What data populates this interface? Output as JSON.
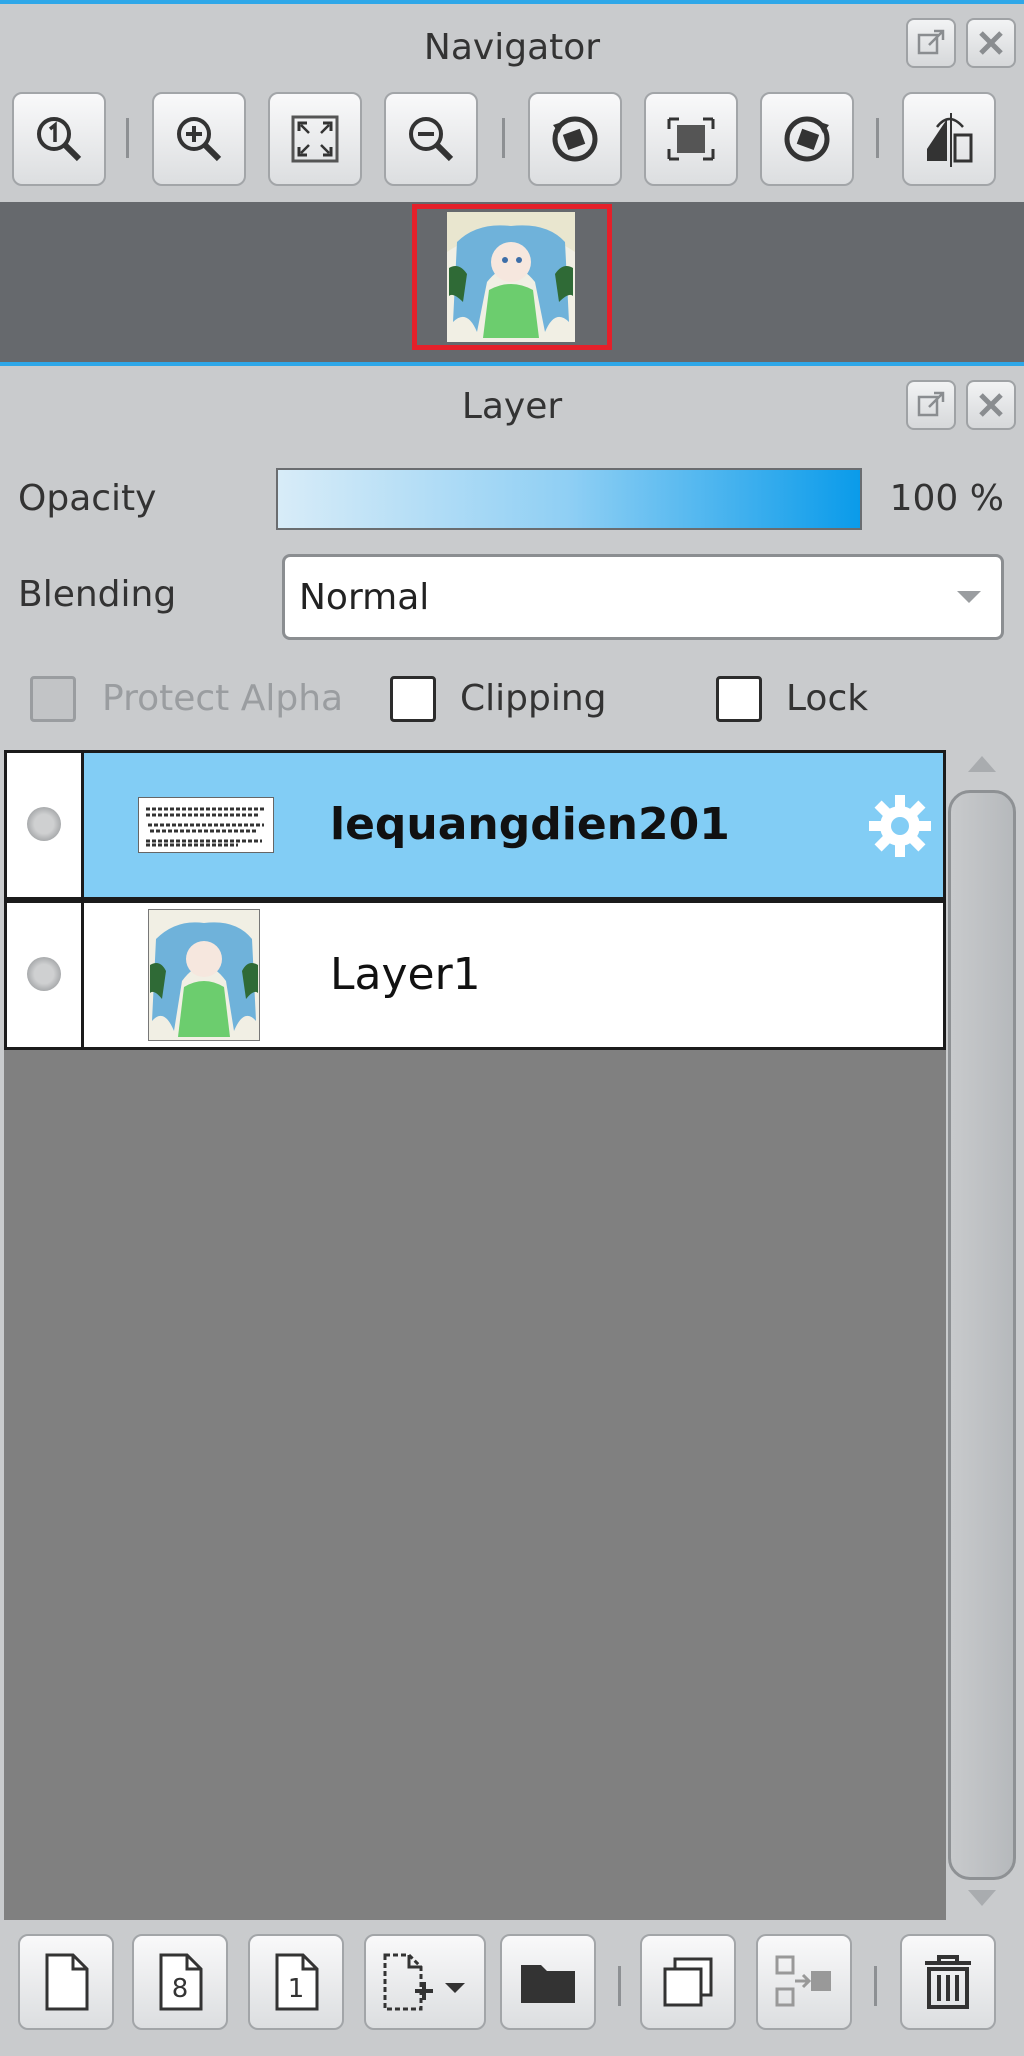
{
  "navigator": {
    "title": "Navigator",
    "toolbar": [
      "zoom-actual-icon",
      "zoom-in-icon",
      "fit-window-icon",
      "zoom-out-icon",
      "rotate-left-icon",
      "reset-rotation-icon",
      "rotate-right-icon",
      "flip-horizontal-icon"
    ]
  },
  "layer_panel": {
    "title": "Layer",
    "opacity_label": "Opacity",
    "opacity_value": "100 %",
    "opacity_fraction": 1.0,
    "blending_label": "Blending",
    "blending_value": "Normal",
    "protect_alpha_label": "Protect Alpha",
    "clipping_label": "Clipping",
    "lock_label": "Lock",
    "layers": [
      {
        "name": "lequangdien201",
        "selected": true
      },
      {
        "name": "Layer1",
        "selected": false
      }
    ]
  },
  "colors": {
    "accent": "#2ea7e8",
    "selected_row": "#82cdf5",
    "nav_frame": "#e4202a",
    "list_bg": "#808080"
  }
}
